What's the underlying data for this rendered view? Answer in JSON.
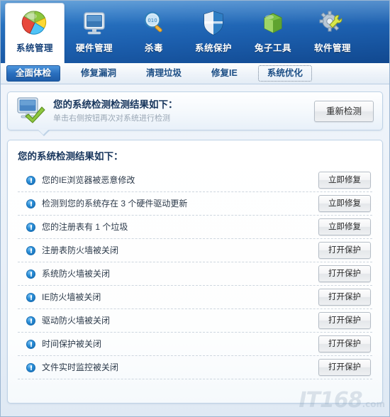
{
  "toolbar": {
    "items": [
      {
        "label": "系统管理",
        "icon": "pie-chart-icon",
        "active": true
      },
      {
        "label": "硬件管理",
        "icon": "monitor-icon",
        "active": false
      },
      {
        "label": "杀毒",
        "icon": "magnifier-icon",
        "active": false
      },
      {
        "label": "系统保护",
        "icon": "shield-icon",
        "active": false
      },
      {
        "label": "兔子工具",
        "icon": "green-box-icon",
        "active": false
      },
      {
        "label": "软件管理",
        "icon": "gear-wrench-icon",
        "active": false
      }
    ]
  },
  "subtabs": {
    "items": [
      {
        "label": "全面体检",
        "state": "active"
      },
      {
        "label": "修复漏洞",
        "state": "normal"
      },
      {
        "label": "清理垃圾",
        "state": "normal"
      },
      {
        "label": "修复IE",
        "state": "normal"
      },
      {
        "label": "系统优化",
        "state": "focused"
      }
    ]
  },
  "banner": {
    "icon": "monitor-check-icon",
    "title": "您的系统检测检测结果如下：",
    "subtitle": "单击右侧按钮再次对系统进行检测",
    "rescan_button": "重新检测"
  },
  "results": {
    "title": "您的系统检测结果如下：",
    "rows": [
      {
        "icon": "info-warning-icon",
        "label": "您的IE浏览器被恶意修改",
        "action": "立即修复"
      },
      {
        "icon": "info-warning-icon",
        "label": "检测到您的系统存在 3 个硬件驱动更新",
        "action": "立即修复"
      },
      {
        "icon": "info-warning-icon",
        "label": "您的注册表有 1 个垃圾",
        "action": "立即修复"
      },
      {
        "icon": "info-warning-icon",
        "label": "注册表防火墙被关闭",
        "action": "打开保护"
      },
      {
        "icon": "info-warning-icon",
        "label": "系统防火墙被关闭",
        "action": "打开保护"
      },
      {
        "icon": "info-warning-icon",
        "label": "IE防火墙被关闭",
        "action": "打开保护"
      },
      {
        "icon": "info-warning-icon",
        "label": "驱动防火墙被关闭",
        "action": "打开保护"
      },
      {
        "icon": "info-warning-icon",
        "label": "时间保护被关闭",
        "action": "打开保护"
      },
      {
        "icon": "info-warning-icon",
        "label": "文件实时监控被关闭",
        "action": "打开保护"
      }
    ]
  },
  "watermark": {
    "text": "IT168",
    "suffix": ".com"
  },
  "colors": {
    "toolbar_blue": "#1c5fae",
    "tab_active_blue": "#2a6fbe",
    "panel_border": "#bed2e6",
    "title_text": "#17355c",
    "warn_icon_blue": "#2a8fd8"
  }
}
